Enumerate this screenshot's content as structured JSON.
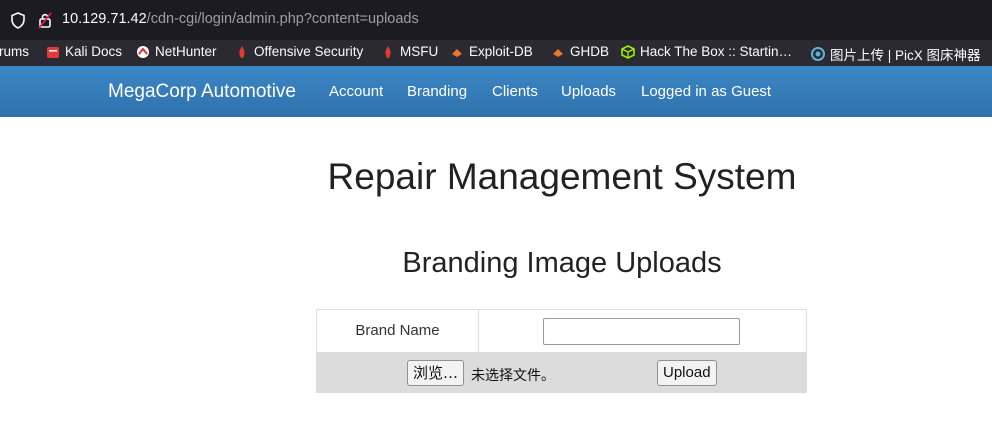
{
  "browser": {
    "url_host": "10.129.71.42",
    "url_path": "/cdn-cgi/login/admin.php?content=uploads",
    "bookmarks": [
      {
        "label": "rums",
        "icon": "none"
      },
      {
        "label": "Kali Docs",
        "icon": "kali-docs-icon"
      },
      {
        "label": "NetHunter",
        "icon": "nethunter-icon"
      },
      {
        "label": "Offensive Security",
        "icon": "offsec-icon"
      },
      {
        "label": "MSFU",
        "icon": "msfu-icon"
      },
      {
        "label": "Exploit-DB",
        "icon": "exploit-db-icon"
      },
      {
        "label": "GHDB",
        "icon": "ghdb-icon"
      },
      {
        "label": "Hack The Box :: Startin…",
        "icon": "htb-icon"
      },
      {
        "label": "图片上传 | PicX 图床神器",
        "icon": "picx-icon"
      }
    ]
  },
  "navbar": {
    "brand": "MegaCorp Automotive",
    "links": [
      "Account",
      "Branding",
      "Clients",
      "Uploads",
      "Logged in as Guest"
    ],
    "color": "#337ab7"
  },
  "main": {
    "title": "Repair Management System",
    "subtitle": "Branding Image Uploads",
    "form": {
      "brand_label": "Brand Name",
      "brand_value": "",
      "browse_label": "浏览…",
      "no_file_text": "未选择文件。",
      "upload_label": "Upload"
    }
  }
}
